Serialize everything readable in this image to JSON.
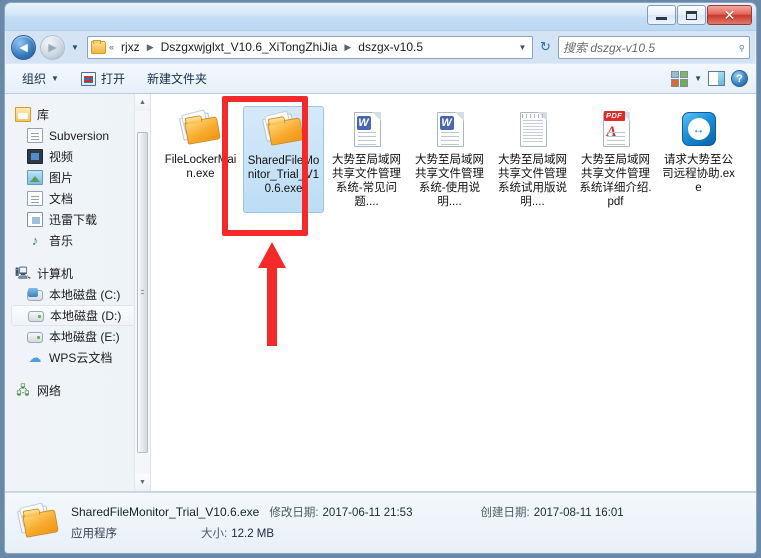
{
  "window": {
    "minimize_label": "Minimize",
    "maximize_label": "Maximize",
    "close_label": "Close"
  },
  "address": {
    "back_label": "◄",
    "forward_label": "►",
    "history_caret": "▼",
    "breadcrumb_overflow": "«",
    "crumbs": [
      "rjxz",
      "Dszgxwjglxt_V10.6_XiTongZhiJia",
      "dszgx-v10.5"
    ],
    "separator": "▶",
    "dropdown_caret": "▼",
    "refresh_label": "↻"
  },
  "search": {
    "placeholder": "搜索 dszgx-v10.5",
    "icon": "search-icon"
  },
  "toolbar": {
    "organize_label": "组织",
    "organize_caret": "▼",
    "open_label": "打开",
    "new_folder_label": "新建文件夹",
    "view_caret": "▼"
  },
  "sidebar": {
    "groups": [
      {
        "root": {
          "label": "库",
          "icon": "library-icon"
        },
        "items": [
          {
            "label": "Subversion",
            "icon": "document-icon"
          },
          {
            "label": "视频",
            "icon": "video-icon"
          },
          {
            "label": "图片",
            "icon": "picture-icon"
          },
          {
            "label": "文档",
            "icon": "document-icon"
          },
          {
            "label": "迅雷下载",
            "icon": "download-icon"
          },
          {
            "label": "音乐",
            "icon": "music-icon"
          }
        ]
      },
      {
        "root": {
          "label": "计算机",
          "icon": "computer-icon"
        },
        "items": [
          {
            "label": "本地磁盘 (C:)",
            "icon": "system-drive-icon",
            "selected": false
          },
          {
            "label": "本地磁盘 (D:)",
            "icon": "drive-icon",
            "selected": true
          },
          {
            "label": "本地磁盘 (E:)",
            "icon": "drive-icon",
            "selected": false
          },
          {
            "label": "WPS云文档",
            "icon": "cloud-icon",
            "selected": false
          }
        ]
      },
      {
        "root": {
          "label": "网络",
          "icon": "network-icon"
        },
        "items": []
      }
    ],
    "scroll_up": "▲",
    "scroll_down": "▼"
  },
  "files": [
    {
      "name": "FileLockerMain.exe",
      "icon": "exe-folder-icon",
      "selected": false,
      "annotated": false
    },
    {
      "name": "SharedFileMonitor_Trial_V10.6.exe",
      "icon": "exe-folder-icon",
      "selected": true,
      "annotated": true
    },
    {
      "name": "大势至局域网共享文件管理系统-常见问题....",
      "icon": "word-doc-icon",
      "selected": false,
      "annotated": false
    },
    {
      "name": "大势至局域网共享文件管理系统-使用说明....",
      "icon": "word-doc-icon",
      "selected": false,
      "annotated": false
    },
    {
      "name": "大势至局域网共享文件管理系统试用版说明....",
      "icon": "text-doc-icon",
      "selected": false,
      "annotated": false
    },
    {
      "name": "大势至局域网共享文件管理系统详细介绍.pdf",
      "icon": "pdf-doc-icon",
      "selected": false,
      "annotated": false
    },
    {
      "name": "请求大势至公司远程协助.exe",
      "icon": "teamviewer-icon",
      "selected": false,
      "annotated": false
    }
  ],
  "annotation": {
    "color": "#f42a2a",
    "shape": "arrow-up"
  },
  "status": {
    "file_name": "SharedFileMonitor_Trial_V10.6.exe",
    "modified_label": "修改日期:",
    "modified_value": "2017-06-11 21:53",
    "created_label": "创建日期:",
    "created_value": "2017-08-11 16:01",
    "type_value": "应用程序",
    "size_label": "大小:",
    "size_value": "12.2 MB"
  }
}
